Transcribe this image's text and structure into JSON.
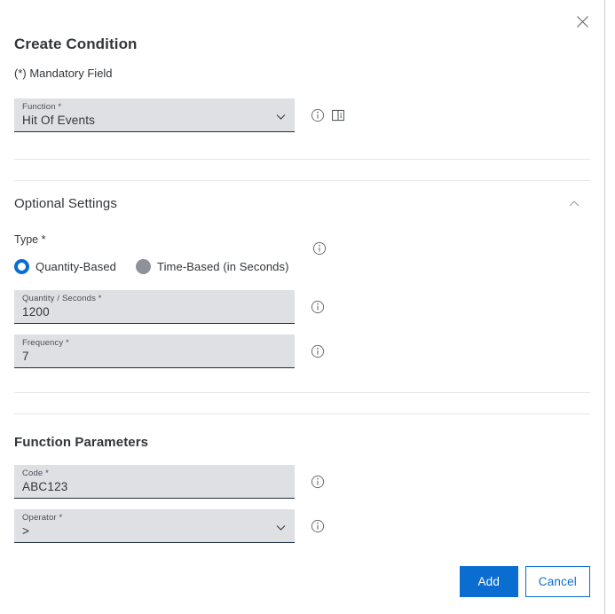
{
  "dialog": {
    "title": "Create Condition",
    "mandatory_note": "(*) Mandatory Field",
    "close_icon": "close-icon"
  },
  "function_field": {
    "label": "Function *",
    "value": "Hit Of Events",
    "chevron_icon": "chevron-down-icon",
    "info_icon": "info-icon",
    "doc_icon": "document-info-icon"
  },
  "optional_settings": {
    "title": "Optional Settings",
    "collapse_icon": "chevron-up-icon",
    "type": {
      "label": "Type *",
      "info_icon": "info-icon",
      "options": [
        {
          "label": "Quantity-Based",
          "selected": true
        },
        {
          "label": "Time-Based (in Seconds)",
          "selected": false
        }
      ]
    },
    "quantity": {
      "label": "Quantity / Seconds *",
      "value": "1200",
      "info_icon": "info-icon"
    },
    "frequency": {
      "label": "Frequency *",
      "value": "7",
      "info_icon": "info-icon"
    }
  },
  "function_parameters": {
    "title": "Function Parameters",
    "code": {
      "label": "Code *",
      "value": "ABC123",
      "info_icon": "info-icon"
    },
    "operator": {
      "label": "Operator *",
      "value": ">",
      "chevron_icon": "chevron-down-icon",
      "info_icon": "info-icon"
    }
  },
  "footer": {
    "add_label": "Add",
    "cancel_label": "Cancel"
  },
  "colors": {
    "accent": "#0a6ed1",
    "field_background": "#dfe0e4",
    "text": "#32363a",
    "radio_off": "#8d9399"
  }
}
